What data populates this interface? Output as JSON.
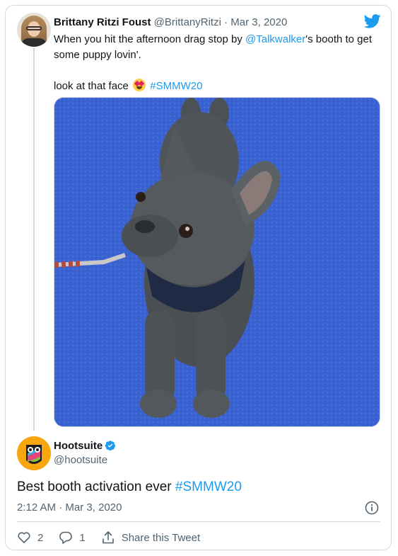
{
  "colors": {
    "link": "#1d9bf0",
    "secondary": "#536471",
    "border": "#cfd9de",
    "verified": "#1d9bf0",
    "carpet": "#3b63d1",
    "hootsuite_bg": "#f7a60e"
  },
  "quoted_tweet": {
    "author_name": "Brittany Ritzi Foust",
    "author_handle": "@BrittanyRitzi",
    "separator": " · ",
    "date": "Mar 3, 2020",
    "text_before_mention": "When you hit the afternoon drag stop by ",
    "mention": "@Talkwalker",
    "text_after_mention": "'s booth to get some puppy lovin'.",
    "line2_text": "look at that face ",
    "emoji_name": "heart-eyes-emoji",
    "hashtag": "#SMMW20",
    "image_name": "french-bulldog-on-blue-carpet-photo"
  },
  "main_tweet": {
    "author_name": "Hootsuite",
    "author_handle": "@hootsuite",
    "text": "Best booth activation ever ",
    "hashtag": "#SMMW20",
    "time": "2:12 AM",
    "separator": " · ",
    "date": "Mar 3, 2020"
  },
  "actions": {
    "like_count": "2",
    "reply_count": "1",
    "share_label": "Share this Tweet"
  },
  "icons": [
    "twitter-bird-icon",
    "verified-badge-icon",
    "info-icon",
    "heart-icon",
    "reply-icon",
    "share-icon"
  ]
}
